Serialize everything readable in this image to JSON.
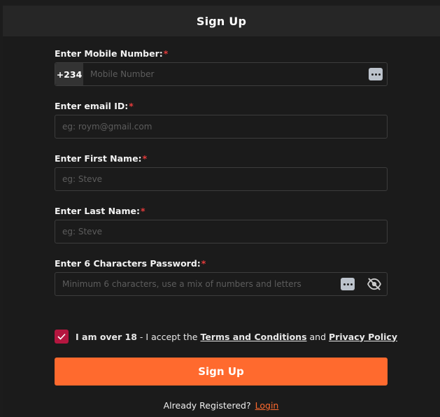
{
  "header": {
    "title": "Sign Up"
  },
  "form": {
    "mobile": {
      "label": "Enter Mobile Number:",
      "required": "*",
      "prefix": "+234",
      "placeholder": "Mobile Number",
      "icon": "password-manager-icon"
    },
    "email": {
      "label": "Enter email ID:",
      "required": "*",
      "placeholder": "eg: roym@gmail.com"
    },
    "first_name": {
      "label": "Enter First Name:",
      "required": "*",
      "placeholder": "eg: Steve"
    },
    "last_name": {
      "label": "Enter Last Name:",
      "required": "*",
      "placeholder": "eg: Steve"
    },
    "password": {
      "label": "Enter 6 Characters Password:",
      "required": "*",
      "placeholder": "Minimum 6 characters, use a mix of numbers and letters",
      "icons": [
        "password-manager-icon",
        "eye-off-icon"
      ]
    }
  },
  "agree": {
    "checked": true,
    "age_text": "I am over 18",
    "dash": " - ",
    "accept_text": "I accept the ",
    "terms_link": "Terms and Conditions",
    "and_text": " and ",
    "privacy_link": "Privacy Policy"
  },
  "submit": {
    "label": "Sign Up"
  },
  "login": {
    "prompt": "Already Registered?",
    "link": "Login"
  },
  "colors": {
    "accent": "#ff6a2e",
    "checkbox": "#b4163f",
    "required": "#e53b3b",
    "background": "#1b1b1b",
    "header": "#262626"
  }
}
